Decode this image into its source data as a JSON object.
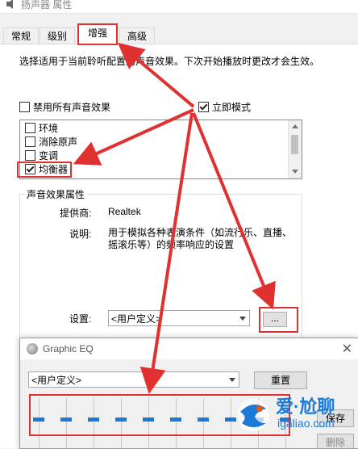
{
  "window": {
    "title": "扬声器 属性",
    "tabs": [
      {
        "label": "常规"
      },
      {
        "label": "级别"
      },
      {
        "label": "增强"
      },
      {
        "label": "高级"
      }
    ]
  },
  "enhancements": {
    "description": "选择适用于当前聆听配置的声音效果。下次开始播放时更改才会生效。",
    "disable_all_label": "禁用所有声音效果",
    "disable_all_checked": false,
    "immediate_mode_label": "立即模式",
    "immediate_mode_checked": true,
    "effects": [
      {
        "label": "环境",
        "checked": false
      },
      {
        "label": "消除原声",
        "checked": false
      },
      {
        "label": "变调",
        "checked": false
      },
      {
        "label": "均衡器",
        "checked": true
      }
    ]
  },
  "properties": {
    "group_label": "声音效果属性",
    "provider_label": "提供商:",
    "provider_value": "Realtek",
    "description_label": "说明:",
    "description_value": "用于模拟各种表演条件（如流行乐、直播、摇滚乐等）的频率响应的设置",
    "setting_label": "设置:",
    "setting_value": "<用户定义>",
    "more_button": "..."
  },
  "eq_dialog": {
    "title": "Graphic EQ",
    "close_icon": "close-icon",
    "preset_value": "<用户定义>",
    "reset_button": "重置",
    "save_button": "保存",
    "delete_button": "删除",
    "band_count": 10
  },
  "watermark": {
    "brand": "爱·尬聊",
    "url": "igaliao.com"
  },
  "colors": {
    "annotation_red": "#e03030",
    "eq_blue": "#1b7ad6"
  }
}
